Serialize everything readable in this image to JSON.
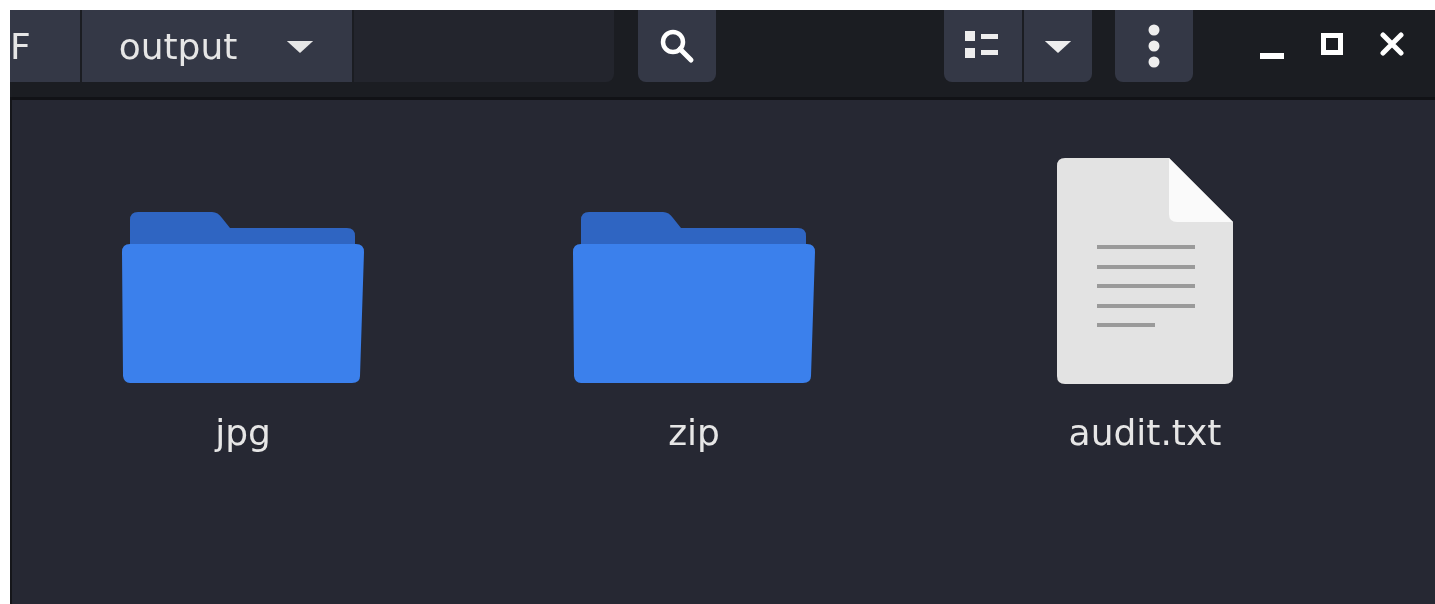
{
  "path_bar": [
    {
      "label": "F",
      "kind": "crumb"
    },
    {
      "label": "output",
      "kind": "current"
    }
  ],
  "items": [
    {
      "name": "jpg",
      "kind": "folder"
    },
    {
      "name": "zip",
      "kind": "folder"
    },
    {
      "name": "audit.txt",
      "kind": "file"
    }
  ]
}
